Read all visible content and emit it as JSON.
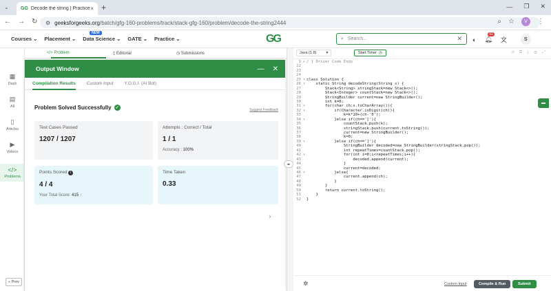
{
  "browser": {
    "tab_title": "Decode the string | Practice | G",
    "tab_favicon": "GG",
    "url_domain": "geeksforgeeks.org",
    "url_path": "/batch/gfg-160-problems/track/stack-gfg-160/problem/decode-the-string2444",
    "profile_initial": "V"
  },
  "header": {
    "nav": [
      "Courses",
      "Placement",
      "Data Science",
      "GATE",
      "Practice"
    ],
    "new_badge": "NEW",
    "logo": "GG",
    "search_placeholder": "Search...",
    "notif_count": "61",
    "user_initial": "S"
  },
  "rail": {
    "items": [
      {
        "label": "Dash",
        "icon": "grid-icon"
      },
      {
        "label": "All",
        "icon": "list-icon"
      },
      {
        "label": "Articles",
        "icon": "book-icon"
      },
      {
        "label": "Videos",
        "icon": "video-icon"
      },
      {
        "label": "Problems",
        "icon": "code-icon"
      }
    ],
    "prev_label": "« Prev"
  },
  "problem_tabs": [
    "Problem",
    "Editorial",
    "Submissions"
  ],
  "output": {
    "title": "Output Window",
    "tabs": [
      "Compilation Results",
      "Custom Input",
      "Y.O.G.I. (AI Bot)"
    ],
    "status": "Problem Solved Successfully",
    "feedback": "Suggest Feedback",
    "test_cases_label": "Test Cases Passed",
    "test_cases_value": "1207 / 1207",
    "attempts_label": "Attempts : Correct / Total",
    "attempts_value": "1 / 1",
    "accuracy_label": "Accuracy :",
    "accuracy_value": "100%",
    "points_label": "Points Scored",
    "points_value": "4 / 4",
    "total_score_label": "Your Total Score:",
    "total_score_value": "415",
    "time_label": "Time Taken",
    "time_value": "0.33"
  },
  "editor": {
    "language": "Java (1.8)",
    "timer": "Start Timer",
    "code_lines": [
      {
        "n": "1",
        "fold": "▸",
        "text": "/ } Driver Code Ends"
      },
      {
        "n": "22",
        "fold": "",
        "text": ""
      },
      {
        "n": "23",
        "fold": "",
        "text": ""
      },
      {
        "n": "24",
        "fold": "",
        "text": ""
      },
      {
        "n": "25",
        "fold": "▾",
        "text": "class Solution {"
      },
      {
        "n": "26",
        "fold": "▾",
        "text": "    static String decodeString(String s) {"
      },
      {
        "n": "27",
        "fold": "",
        "text": "        Stack<String> stringStack=new Stack<>();"
      },
      {
        "n": "28",
        "fold": "",
        "text": "        Stack<Integer> countStack=new Stack<>();"
      },
      {
        "n": "29",
        "fold": "",
        "text": "        StringBuilder current=new StringBuilder();"
      },
      {
        "n": "30",
        "fold": "",
        "text": "        int k=0;"
      },
      {
        "n": "31",
        "fold": "▾",
        "text": "        for(char ch:s.toCharArray()){"
      },
      {
        "n": "32",
        "fold": "▾",
        "text": "            if(Character.isDigit(ch)){"
      },
      {
        "n": "33",
        "fold": "",
        "text": "                k=k*10+(ch-'0');"
      },
      {
        "n": "34",
        "fold": "▾",
        "text": "            }else if(ch=='['){"
      },
      {
        "n": "35",
        "fold": "",
        "text": "                countStack.push(k);"
      },
      {
        "n": "36",
        "fold": "",
        "text": "                stringStack.push(current.toString());"
      },
      {
        "n": "37",
        "fold": "",
        "text": "                current=new StringBuilder();"
      },
      {
        "n": "38",
        "fold": "",
        "text": "                k=0;"
      },
      {
        "n": "39",
        "fold": "▾",
        "text": "            }else if(ch==']'){"
      },
      {
        "n": "40",
        "fold": "",
        "text": "                StringBuilder decoded=new StringBuilder(stringStack.pop());"
      },
      {
        "n": "41",
        "fold": "",
        "text": "                int repeatTimes=countStack.pop();"
      },
      {
        "n": "42",
        "fold": "▾",
        "text": "                for(int i=0;i<repeatTimes;i++){"
      },
      {
        "n": "43",
        "fold": "",
        "text": "                    decoded.append(current);"
      },
      {
        "n": "44",
        "fold": "",
        "text": "                }"
      },
      {
        "n": "45",
        "fold": "",
        "text": "                current=decoded;"
      },
      {
        "n": "46",
        "fold": "▾",
        "text": "            }else{"
      },
      {
        "n": "47",
        "fold": "",
        "text": "                current.append(ch);"
      },
      {
        "n": "48",
        "fold": "",
        "text": "            }"
      },
      {
        "n": "49",
        "fold": "",
        "text": "        }"
      },
      {
        "n": "50",
        "fold": "",
        "text": "        return current.toString();"
      },
      {
        "n": "51",
        "fold": "",
        "text": "    }"
      },
      {
        "n": "52",
        "fold": "",
        "text": "}"
      }
    ],
    "custom_input": "Custom Input",
    "compile_label": "Compile & Run",
    "submit_label": "Submit"
  },
  "colors": {
    "brand_green": "#2f8d46",
    "info_blue_card": "#e6f6fb"
  }
}
